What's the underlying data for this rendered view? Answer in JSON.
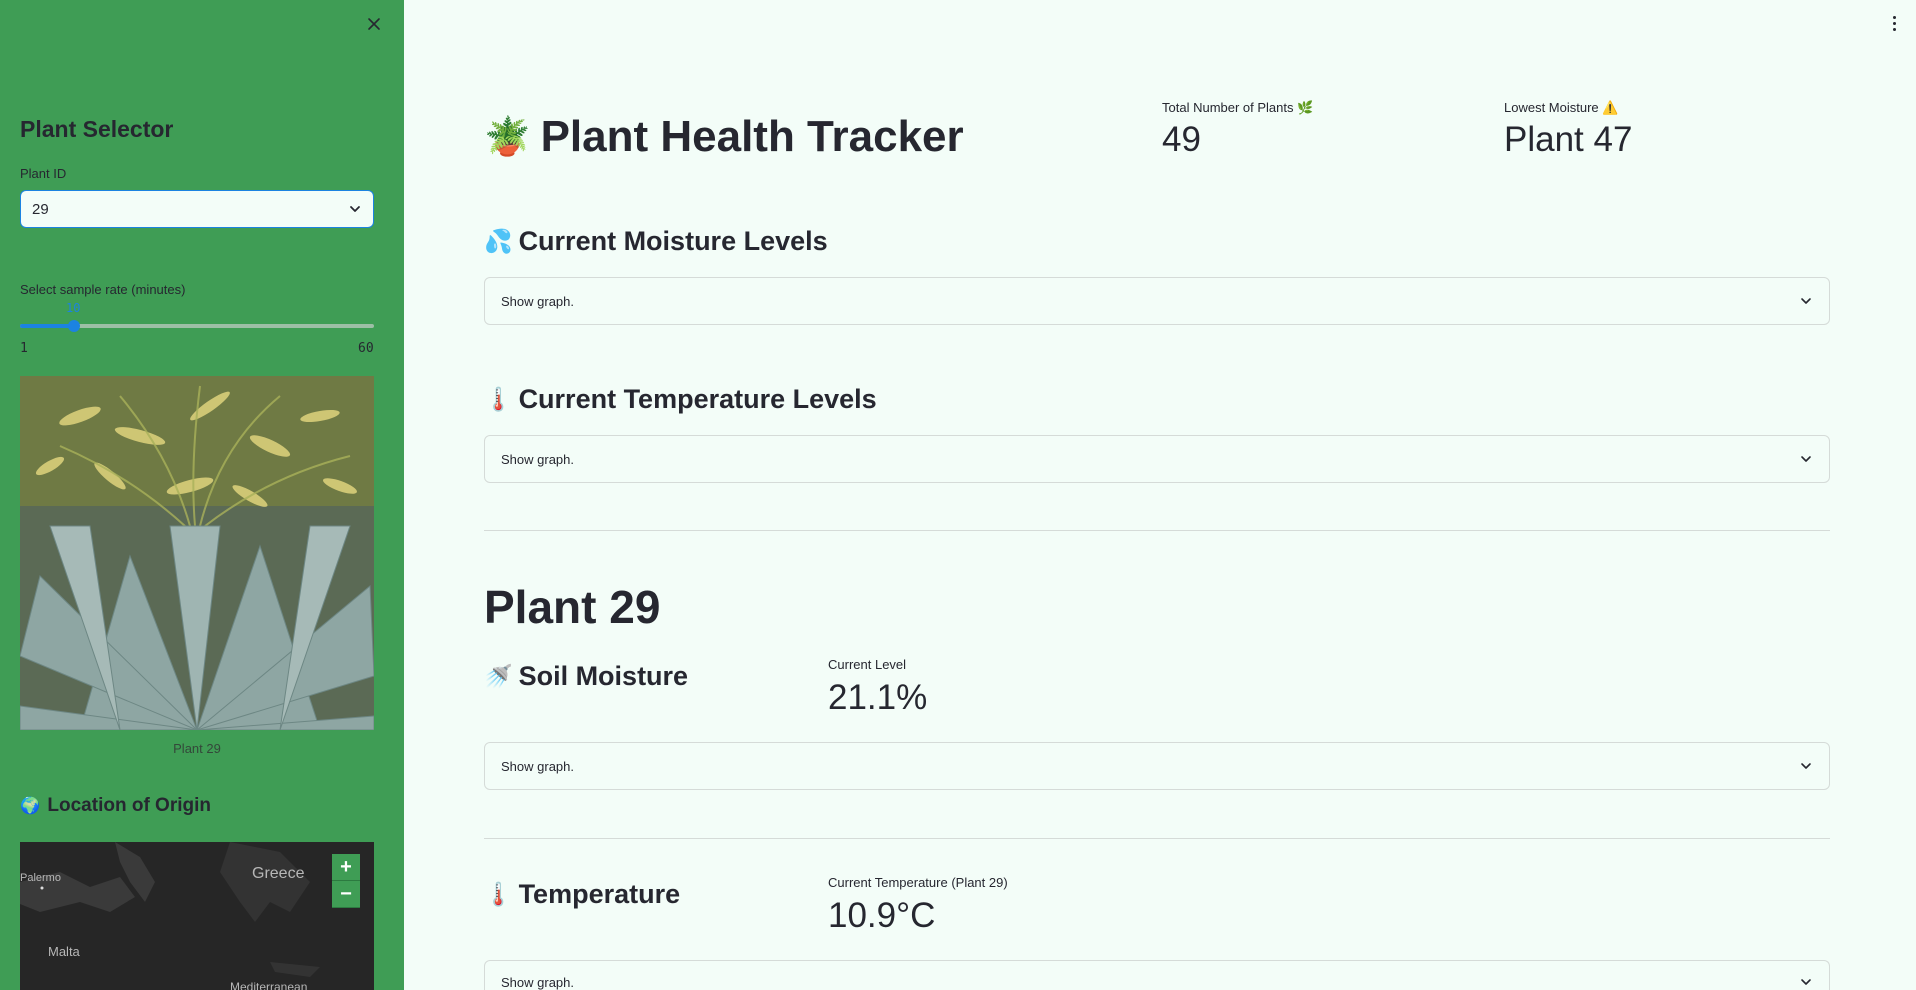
{
  "sidebar": {
    "heading": "Plant Selector",
    "plant_id_label": "Plant ID",
    "plant_id_value": "29",
    "sample_rate_label": "Select sample rate (minutes)",
    "slider": {
      "value": "10",
      "min": "1",
      "max": "60",
      "value_fraction": 0.153
    },
    "image_caption": "Plant 29",
    "location_heading": "Location of Origin",
    "location_emoji": "🌍",
    "map": {
      "labels": [
        "Palermo",
        "Malta",
        "Greece",
        "Mediterranean"
      ],
      "zoom_in": "+",
      "zoom_out": "−"
    },
    "icons": {
      "close": "close-icon",
      "chevron": "chevron-down-icon"
    }
  },
  "main": {
    "title": "Plant Health Tracker",
    "title_emoji": "🪴",
    "metrics": [
      {
        "label": "Total Number of Plants 🌿",
        "value": "49"
      },
      {
        "label": "Lowest Moisture ⚠️",
        "value": "Plant 47"
      }
    ],
    "sections": {
      "moisture": {
        "emoji": "💦",
        "title": "Current Moisture Levels",
        "expander": "Show graph."
      },
      "temperature": {
        "emoji": "🌡️",
        "title": "Current Temperature Levels",
        "expander": "Show graph."
      }
    },
    "plant": {
      "title": "Plant 29",
      "soil": {
        "emoji": "🚿",
        "title": "Soil Moisture",
        "metric_label": "Current Level",
        "metric_value": "21.1%",
        "expander": "Show graph."
      },
      "temp": {
        "emoji": "🌡️",
        "title": "Temperature",
        "metric_label": "Current Temperature (Plant 29)",
        "metric_value": "10.9°C",
        "expander": "Show graph."
      }
    }
  },
  "colors": {
    "sidebar_bg": "#3f9d55",
    "main_bg": "#f3fdf8",
    "accent": "#1c83e1"
  }
}
